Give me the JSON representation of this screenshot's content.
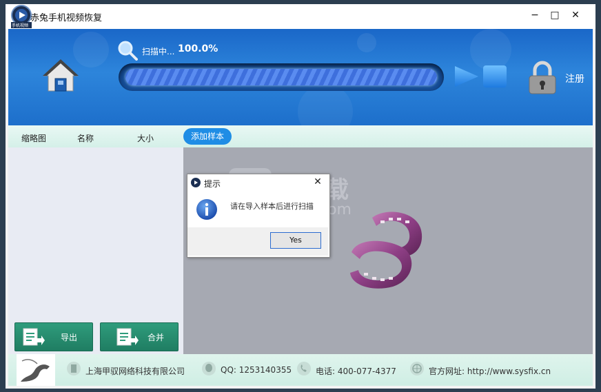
{
  "window": {
    "title": "赤兔手机视频恢复",
    "logo_label": "手机视频",
    "minimize": "−",
    "maximize": "□",
    "close": "✕"
  },
  "header": {
    "scan_label": "扫描中...",
    "scan_percent": "100.0%",
    "progress": 1.0,
    "register_label": "注册"
  },
  "columns": {
    "thumbnail": "缩略图",
    "name": "名称",
    "size": "大小",
    "add_sample": "添加样本"
  },
  "buttons": {
    "export": "导出",
    "merge": "合并"
  },
  "dialog": {
    "title": "提示",
    "message": "请在导入样本后进行扫描",
    "yes": "Yes"
  },
  "watermark": {
    "text": "安下载",
    "sub": "anxz.com"
  },
  "footer": {
    "company": "上海甲驭网络科技有限公司",
    "qq": "QQ: 1253140355",
    "phone": "电话: 400-077-4377",
    "website": "官方网址: http://www.sysfix.cn"
  },
  "colors": {
    "header_blue": "#1d6fcb",
    "accent_button": "#1f8de5",
    "green_button": "#2f9c7c"
  }
}
